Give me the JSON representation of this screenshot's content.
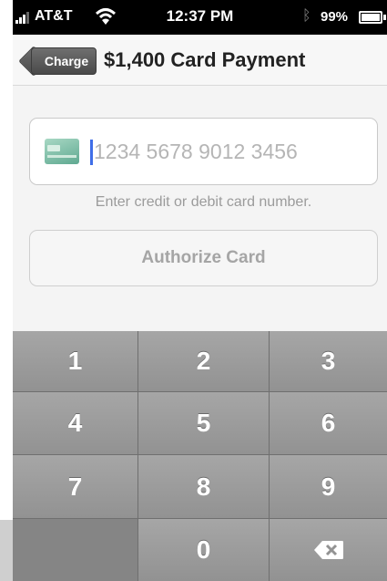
{
  "status_bar": {
    "carrier": "AT&T",
    "time": "12:37 PM",
    "battery": "99%"
  },
  "nav": {
    "back_label": "Charge",
    "title": "$1,400 Card Payment"
  },
  "card": {
    "placeholder": "1234 5678 9012 3456",
    "value": "",
    "helper": "Enter credit or debit card number."
  },
  "actions": {
    "authorize_label": "Authorize Card"
  },
  "keypad": {
    "keys": [
      "1",
      "2",
      "3",
      "4",
      "5",
      "6",
      "7",
      "8",
      "9",
      "",
      "0",
      "delete"
    ]
  },
  "icons": {
    "wifi": "wifi-icon",
    "bluetooth": "bluetooth-icon",
    "battery": "battery-icon",
    "card": "credit-card-icon",
    "delete": "backspace-icon"
  },
  "colors": {
    "caret": "#3f6ee8",
    "nav_back": "#555555",
    "keypad": "#999999"
  }
}
